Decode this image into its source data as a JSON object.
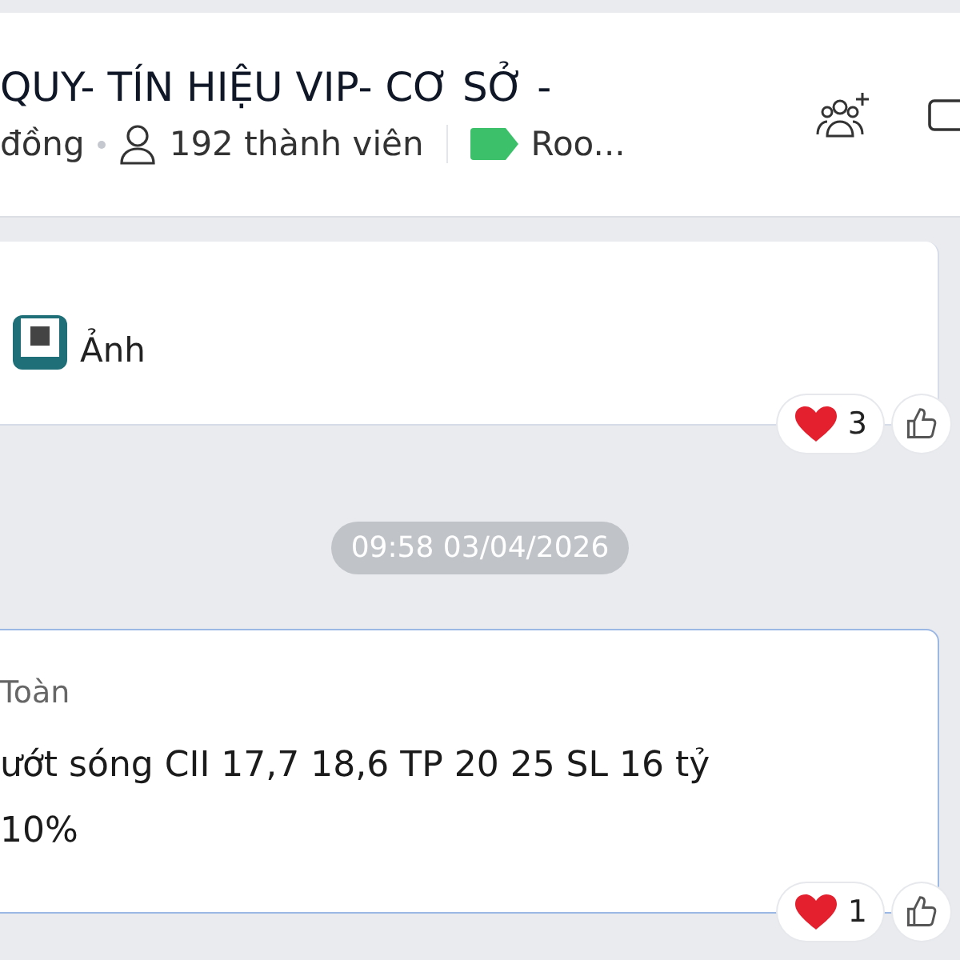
{
  "header": {
    "title": "QUY- TÍN HIỆU VIP- CƠ SỞ -",
    "status": "đồng",
    "members": "192 thành viên",
    "tag": {
      "label": "Roo...",
      "color": "#3cc06a"
    }
  },
  "messages": [
    {
      "kind": "attachment",
      "label": "Ảnh",
      "reactions": {
        "count": "3"
      }
    },
    {
      "kind": "timestamp",
      "text": "09:58 03/04/2026"
    },
    {
      "kind": "text",
      "sender": "Toàn",
      "lines": [
        "ướt sóng CII 17,7 18,6 TP 20 25 SL 16 tỷ",
        "10%"
      ],
      "reactions": {
        "count": "1"
      }
    }
  ]
}
